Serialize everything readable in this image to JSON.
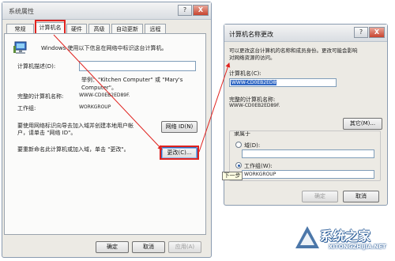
{
  "left_window": {
    "title": "系统属性",
    "help_btn": "?",
    "close_btn": "X",
    "tabs": [
      "常规",
      "计算机名",
      "硬件",
      "高级",
      "自动更新",
      "远程"
    ],
    "intro": "Windows 使用以下信息在网络中标识这台计算机。",
    "desc_label": "计算机描述(D):",
    "desc_value": "",
    "example_line1": "举例：\"Kitchen Computer\" 或 \"Mary's",
    "example_line2": "Computer\"。",
    "fullname_label": "完整的计算机名称:",
    "fullname_value": "WWW-CD0EB2ED89F.",
    "workgroup_label": "工作组:",
    "workgroup_value": "WORKGROUP",
    "network_text_line1": "要使用网络标识向导去加入域并创建本地用户帐",
    "network_text_line2": "户，请单击 \"网络 ID\"。",
    "network_id_btn": "网络 ID(N)",
    "rename_text": "要重新命名此计算机或加入域，单击 \"更改\"。",
    "change_btn": "更改(C)...",
    "ok_btn": "确定",
    "cancel_btn": "取消",
    "apply_btn": "应用(A)"
  },
  "right_window": {
    "title": "计算机名称更改",
    "help_btn": "?",
    "close_btn": "X",
    "intro_line1": "可以更改这台计算机的名称和成员身份。更改可能会影响",
    "intro_line2": "对网络资源的访问。",
    "name_label": "计算机名(C):",
    "name_value": "WWW-CD0EB2ED89F",
    "fullname_label": "完整的计算机名称:",
    "fullname_value": "WWW-CD0EB2ED89F.",
    "other_btn": "其它(M)...",
    "member_of": "隶属于",
    "domain_radio": "域(D):",
    "domain_value": "",
    "workgroup_radio": "工作组(W):",
    "workgroup_value": "WORKGROUP",
    "ok_btn": "确定",
    "cancel_btn": "取消"
  },
  "tooltip": "下一步",
  "watermark": {
    "text": "系统之家",
    "url": "XITONGZHIJIA.NET"
  },
  "colors": {
    "highlight_red": "#e0231f",
    "selection_blue": "#3168c4"
  }
}
